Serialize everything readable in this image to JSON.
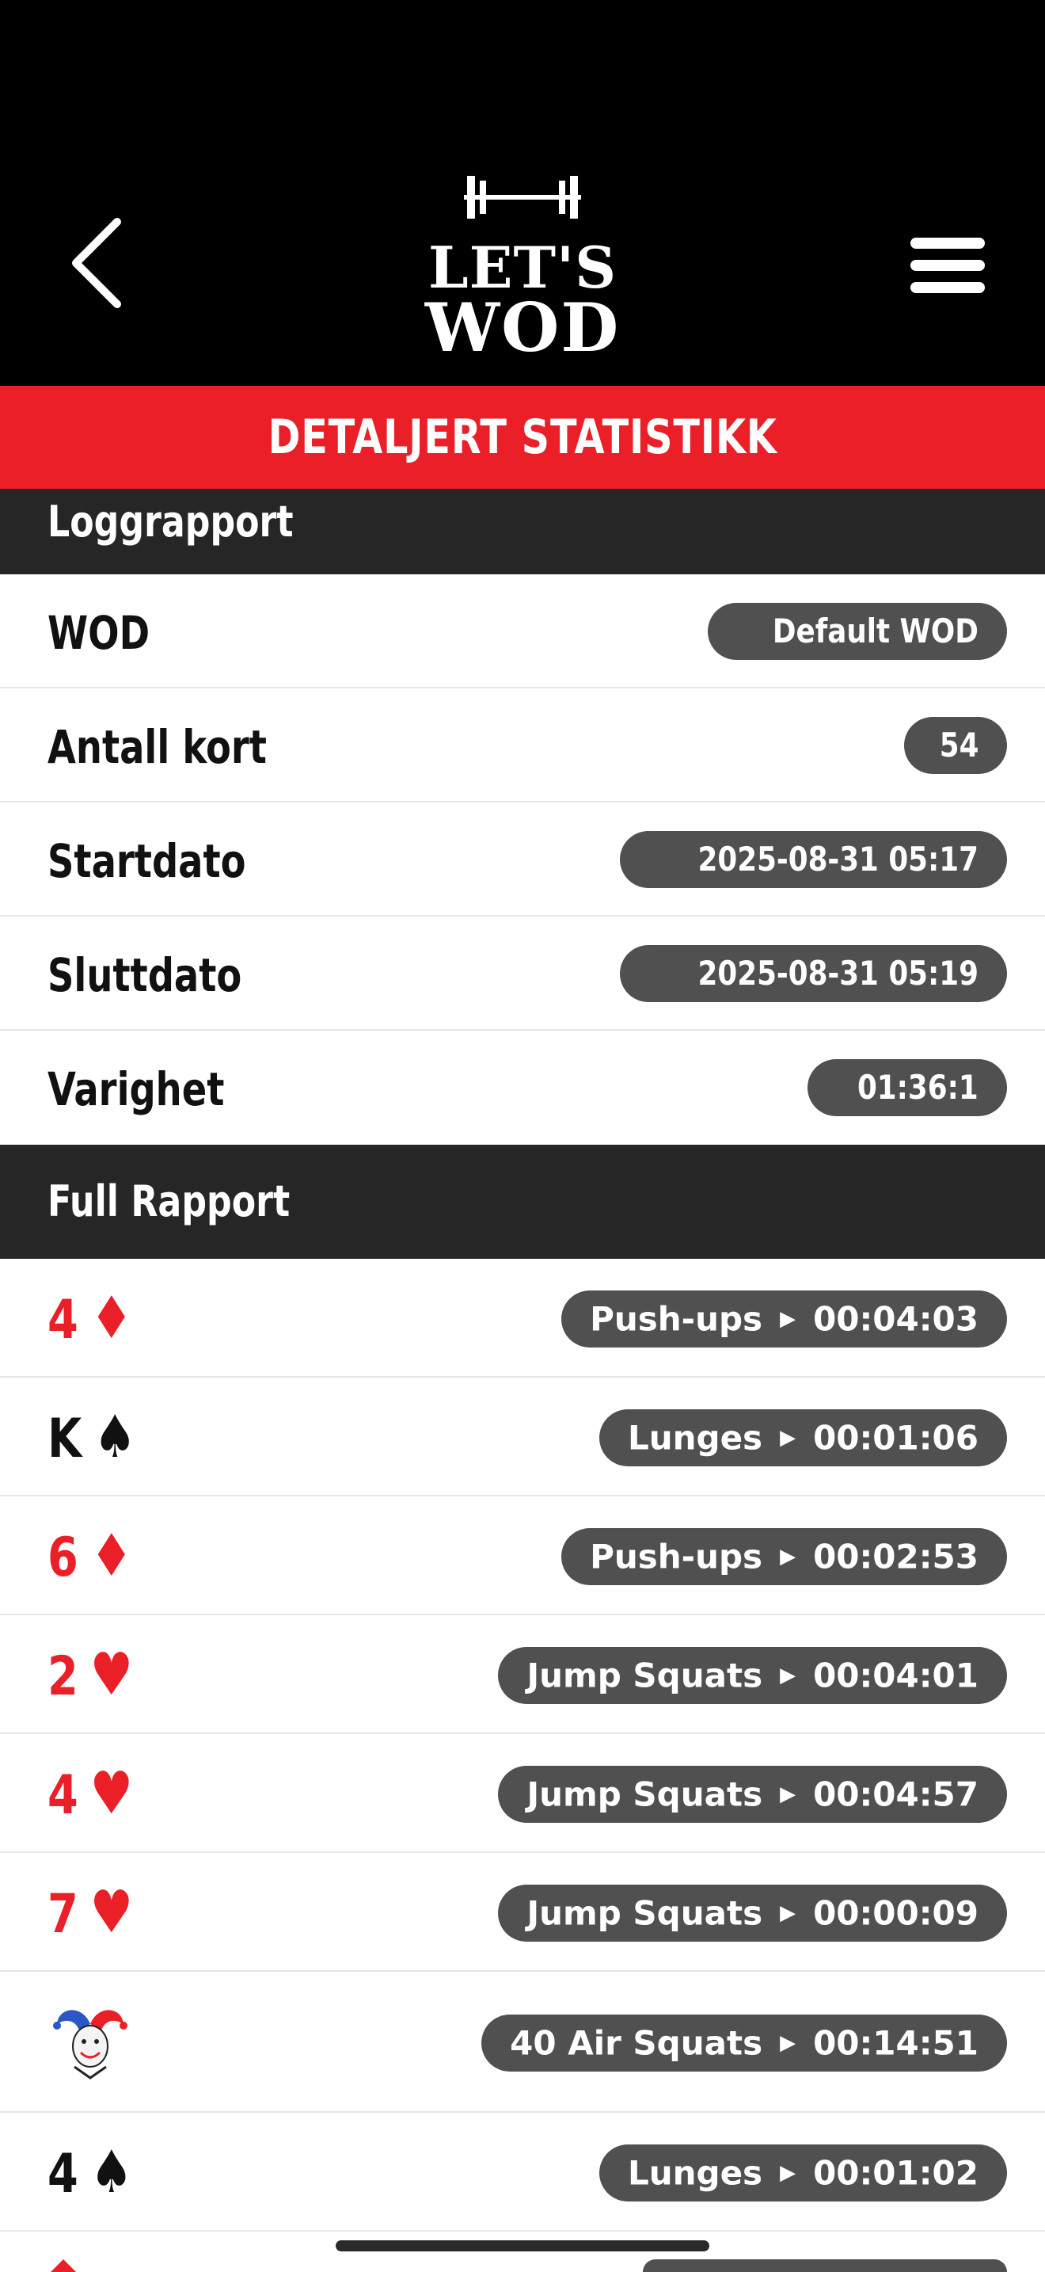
{
  "header": {
    "logo_line1": "LET'S",
    "logo_line2": "WOD",
    "back_icon": "chevron-left-icon",
    "menu_icon": "hamburger-menu-icon"
  },
  "page_title": "DETALJERT STATISTIKK",
  "log_report": {
    "heading": "Loggrapport",
    "rows": [
      {
        "label": "WOD",
        "value": "Default WOD"
      },
      {
        "label": "Antall kort",
        "value": "54"
      },
      {
        "label": "Startdato",
        "value": "2025-08-31 05:17"
      },
      {
        "label": "Sluttdato",
        "value": "2025-08-31 05:19"
      },
      {
        "label": "Varighet",
        "value": "01:36:1"
      }
    ]
  },
  "full_report": {
    "heading": "Full Rapport",
    "cards": [
      {
        "rank": "4",
        "suit": "♦",
        "color": "#ea1f27",
        "exercise": "Push-ups",
        "time": "00:04:03"
      },
      {
        "rank": "K",
        "suit": "♠",
        "color": "#111111",
        "exercise": "Lunges",
        "time": "00:01:06"
      },
      {
        "rank": "6",
        "suit": "♦",
        "color": "#ea1f27",
        "exercise": "Push-ups",
        "time": "00:02:53"
      },
      {
        "rank": "2",
        "suit": "♥",
        "color": "#ea1f27",
        "exercise": "Jump Squats",
        "time": "00:04:01"
      },
      {
        "rank": "4",
        "suit": "♥",
        "color": "#ea1f27",
        "exercise": "Jump Squats",
        "time": "00:04:57"
      },
      {
        "rank": "7",
        "suit": "♥",
        "color": "#ea1f27",
        "exercise": "Jump Squats",
        "time": "00:00:09"
      },
      {
        "rank": "",
        "suit": "",
        "icon": "joker-icon",
        "exercise": "40 Air Squats",
        "time": "00:14:51"
      },
      {
        "rank": "4",
        "suit": "♠",
        "color": "#111111",
        "exercise": "Lunges",
        "time": "00:01:02"
      }
    ]
  },
  "colors": {
    "accent_red": "#ea1f27",
    "header_bg": "#000000",
    "section_bg": "#262626",
    "pill_bg": "#505050"
  }
}
